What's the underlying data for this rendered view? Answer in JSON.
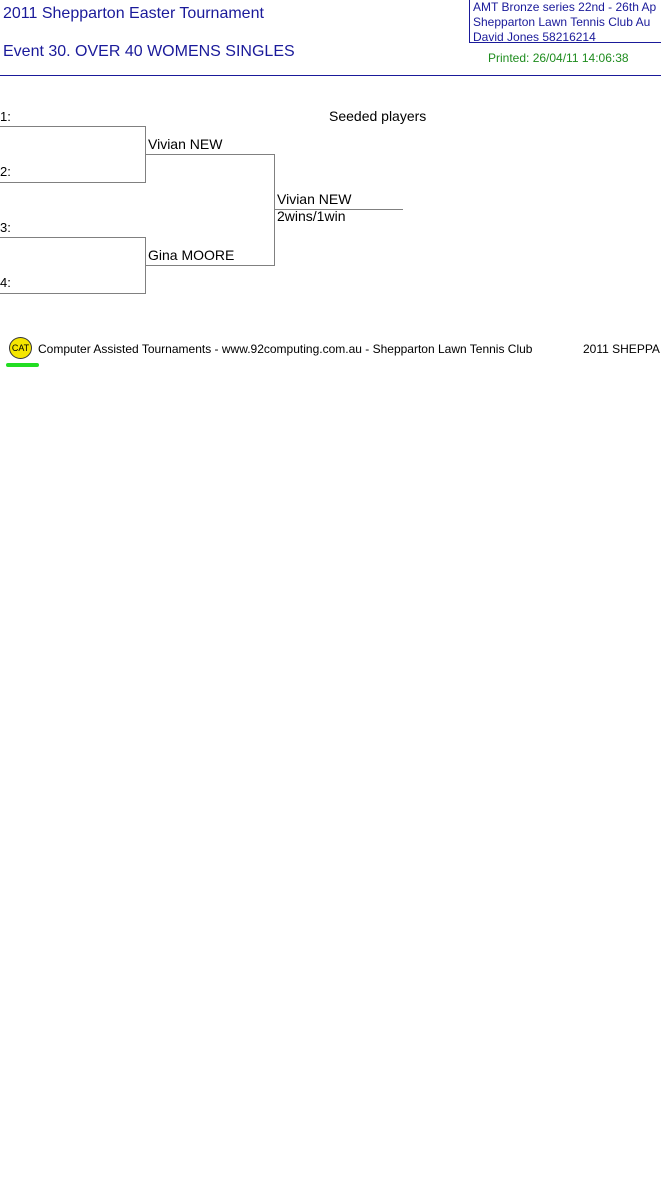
{
  "header": {
    "title": "2011 Shepparton Easter Tournament",
    "event": "Event 30. OVER 40 WOMENS SINGLES",
    "info": {
      "series": "AMT Bronze series   22nd - 26th Ap",
      "club": "Shepparton Lawn Tennis Club   Au",
      "contact": "David Jones   58216214"
    },
    "printed": "Printed: 26/04/11 14:06:38"
  },
  "draw": {
    "seeded_label": "Seeded players",
    "positions": [
      "1:",
      "2:",
      "3:",
      "4:"
    ],
    "round2": {
      "top": "Vivian NEW",
      "bottom": "Gina MOORE"
    },
    "final": {
      "winner": "Vivian NEW",
      "score": "2wins/1win"
    }
  },
  "footer": {
    "logo_text": "CAT",
    "text": "Computer Assisted Tournaments - www.92computing.com.au -  Shepparton Lawn Tennis Club",
    "right": "2011 SHEPPA",
    "colors": {
      "logo": "#f5e600",
      "underline": "#22dd22"
    }
  }
}
